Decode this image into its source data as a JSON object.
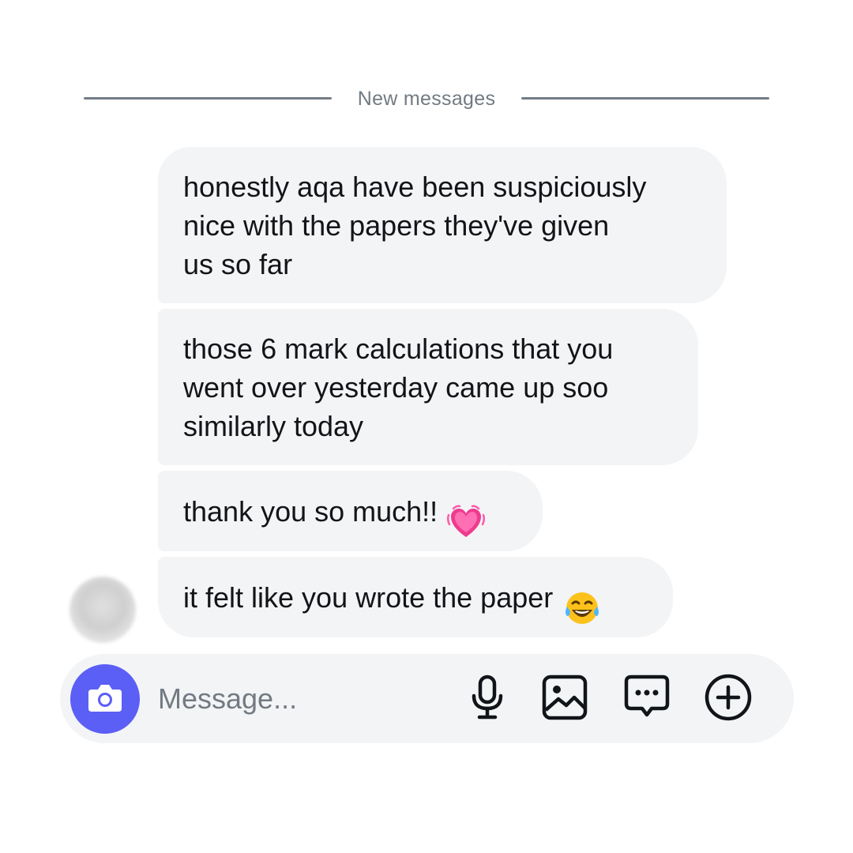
{
  "divider": {
    "label": "New messages"
  },
  "messages": [
    {
      "text": "honestly aqa have been suspiciously\nnice with the papers they've given\nus so far"
    },
    {
      "text": "those 6 mark calculations that you\nwent over yesterday came up soo\nsimilarly today"
    },
    {
      "text": "thank you so much!!",
      "emoji": "heart-with-ribbons"
    },
    {
      "text": "it felt like you wrote the paper",
      "emoji": "tears-of-joy"
    }
  ],
  "composer": {
    "placeholder": "Message...",
    "value": "",
    "icons": [
      "camera-icon",
      "microphone-icon",
      "image-icon",
      "sticker-message-icon",
      "plus-icon"
    ]
  },
  "colors": {
    "bubble_bg": "#f3f4f6",
    "accent": "#5b5ff5",
    "divider": "#737c85",
    "text": "#121417",
    "muted": "#727a82"
  }
}
